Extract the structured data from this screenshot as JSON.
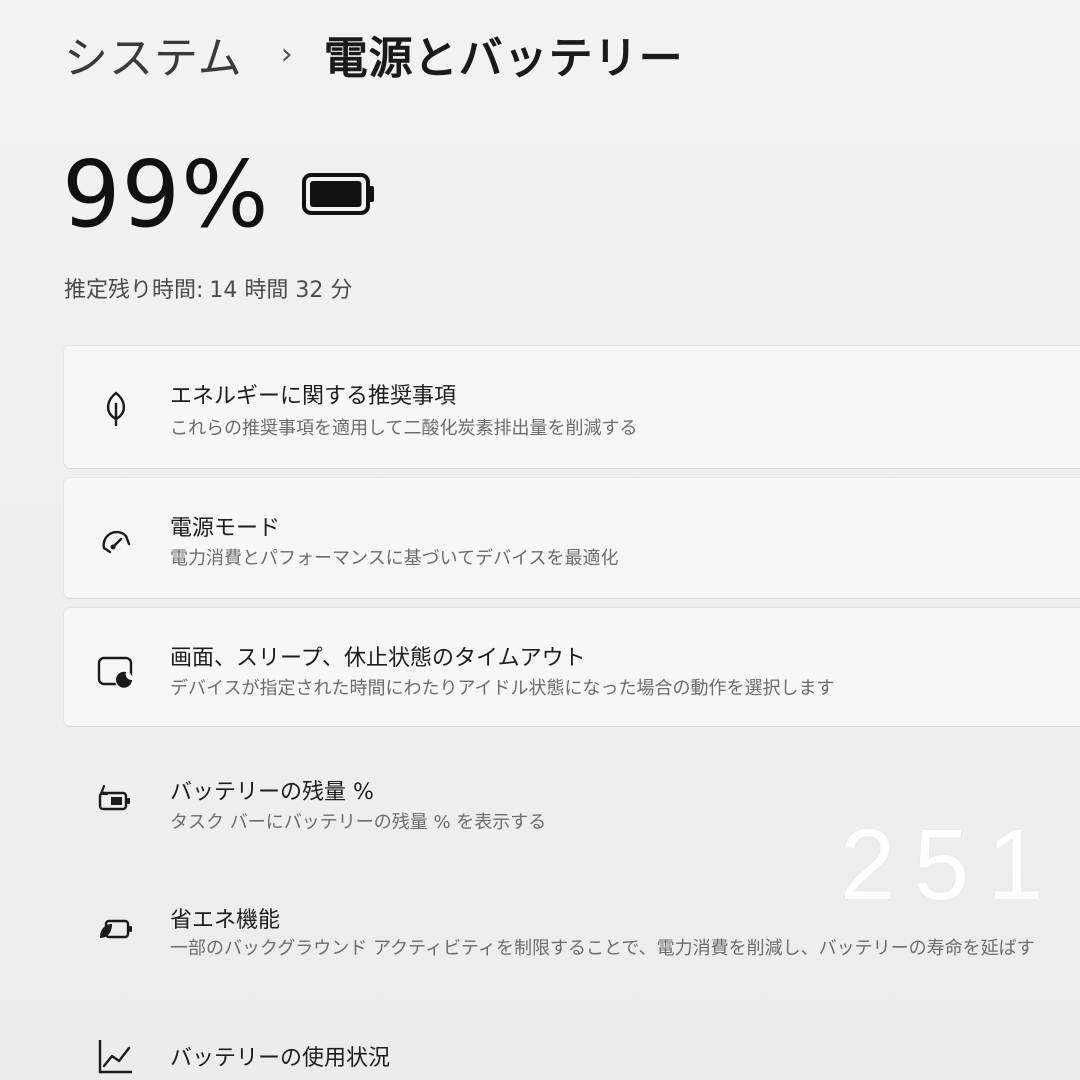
{
  "breadcrumb": {
    "parent": "システム",
    "separator": "›",
    "current": "電源とバッテリー"
  },
  "battery": {
    "percent_text": "99%",
    "level": 0.99,
    "remaining_label": "推定残り時間:",
    "remaining_value": "14 時間 32 分"
  },
  "settings": [
    {
      "icon": "leaf-icon",
      "title": "エネルギーに関する推奨事項",
      "desc": "これらの推奨事項を適用して二酸化炭素排出量を削減する"
    },
    {
      "icon": "power-mode-gauge-icon",
      "title": "電源モード",
      "desc": "電力消費とパフォーマンスに基づいてデバイスを最適化"
    },
    {
      "icon": "screen-sleep-icon",
      "title": "画面、スリープ、休止状態のタイムアウト",
      "desc": "デバイスが指定された時間にわたりアイドル状態になった場合の動作を選択します"
    },
    {
      "icon": "battery-percentage-icon",
      "title": "バッテリーの残量 %",
      "desc": "タスク バーにバッテリーの残量 % を表示する"
    },
    {
      "icon": "battery-saver-icon",
      "title": "省エネ機能",
      "desc": "一部のバックグラウンド アクティビティを制限することで、電力消費を削減し、バッテリーの寿命を延ばす"
    },
    {
      "icon": "usage-chart-icon",
      "title": "バッテリーの使用状況",
      "desc": ""
    }
  ],
  "overlay_number": "251",
  "colors": {
    "background": "#f1f1f1",
    "card": "#f7f7f7",
    "text": "#1b1b1b",
    "secondary_text": "#6c6c6c"
  }
}
